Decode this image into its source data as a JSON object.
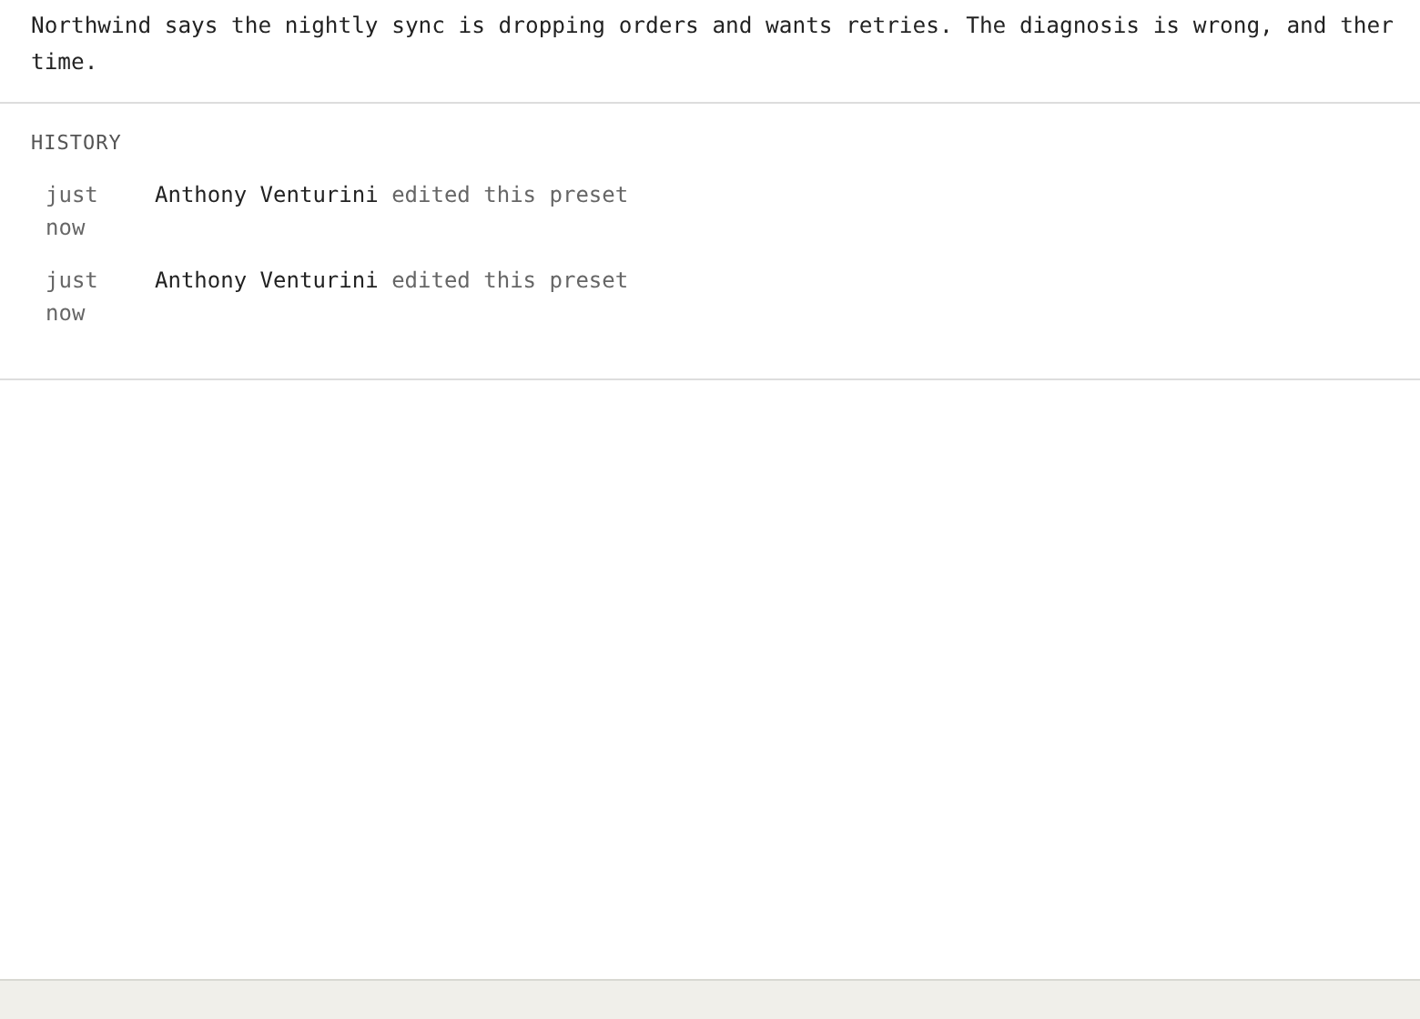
{
  "description": {
    "lines": [
      "Northwind says the nightly sync is dropping orders and wants retries. The diagnosis is wrong, and ther",
      "time."
    ]
  },
  "history": {
    "title": "HISTORY",
    "entries": [
      {
        "time": "just now",
        "author": "Anthony Venturini",
        "action": "edited this preset"
      },
      {
        "time": "just now",
        "author": "Anthony Venturini",
        "action": "edited this preset"
      }
    ]
  }
}
